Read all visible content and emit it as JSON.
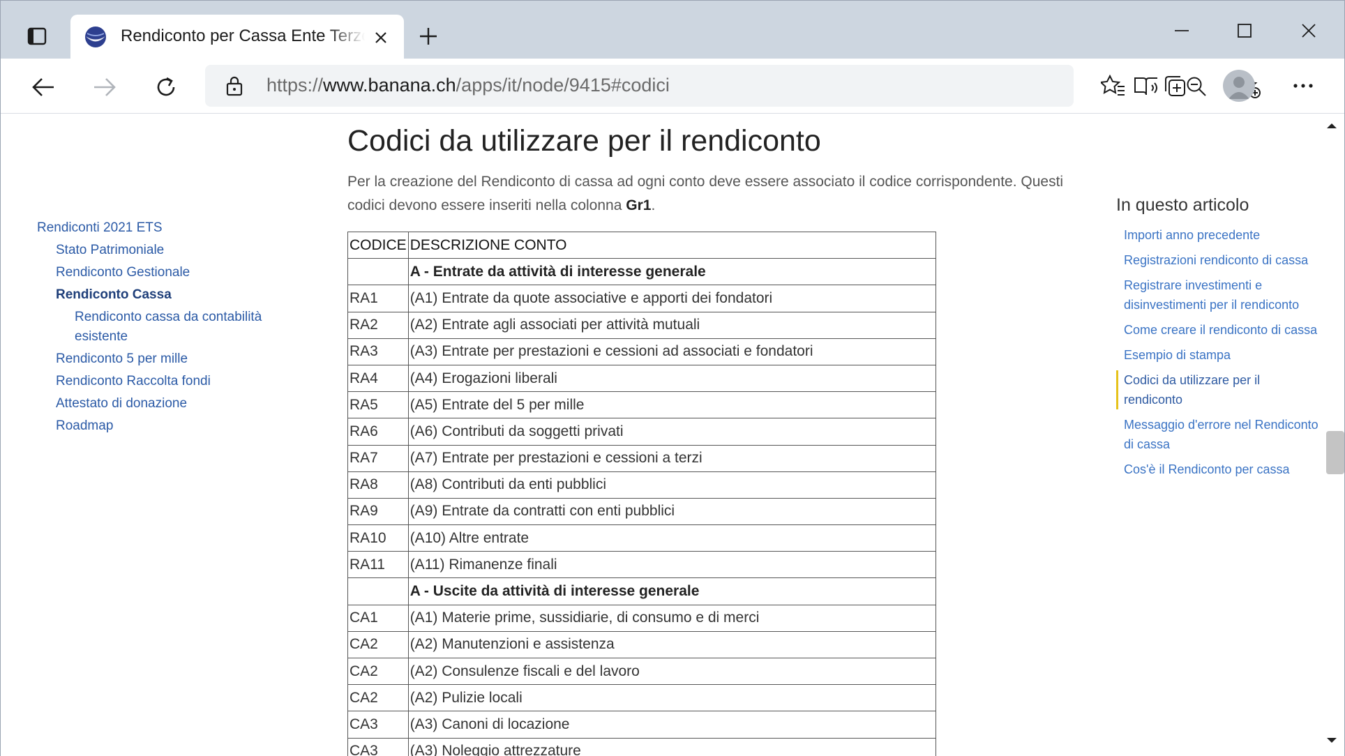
{
  "browser": {
    "tab": {
      "title": "Rendiconto per Cassa Ente Terzo Settore"
    },
    "address": {
      "scheme": "https://",
      "host": "www.banana.ch",
      "path": "/apps/it/node/9415#codici"
    },
    "icons": {
      "tab_actions": "tab-actions-icon",
      "favicon": "banana-logo-icon",
      "close_tab": "close-icon",
      "new_tab": "plus-icon",
      "minimize": "minimize-icon",
      "maximize": "maximize-icon",
      "close_window": "close-icon",
      "back": "arrow-left-icon",
      "forward": "arrow-right-icon",
      "refresh": "refresh-icon",
      "lock": "lock-icon",
      "read_aloud": "immersive-reader-icon",
      "zoom": "zoom-out-icon",
      "add_favorite": "star-add-icon",
      "favorites": "favorites-icon",
      "collections": "collections-icon",
      "profile": "profile-avatar-icon",
      "menu": "more-icon"
    },
    "colors": {
      "titlebar": "#cdd6e0",
      "link": "#2b5aa6",
      "toc_accent": "#e6c21a"
    }
  },
  "left_nav": {
    "items": [
      {
        "label": "Rendiconti 2021 ETS",
        "level": 1
      },
      {
        "label": "Stato Patrimoniale",
        "level": 2
      },
      {
        "label": "Rendiconto Gestionale",
        "level": 2
      },
      {
        "label": "Rendiconto Cassa",
        "level": 2,
        "active": true
      },
      {
        "label": "Rendiconto cassa da contabilità esistente",
        "level": 3
      },
      {
        "label": "Rendiconto 5 per mille",
        "level": 2
      },
      {
        "label": "Rendiconto Raccolta fondi",
        "level": 2
      },
      {
        "label": "Attestato di donazione",
        "level": 2
      },
      {
        "label": "Roadmap",
        "level": 2
      }
    ]
  },
  "article": {
    "title": "Codici da utilizzare per il rendiconto",
    "intro_before": "Per la creazione del Rendiconto di cassa ad ogni conto deve essere associato il codice corrispondente. Questi codici devono essere inseriti nella colonna ",
    "intro_bold": "Gr1",
    "intro_after": ".",
    "table": {
      "headers": [
        "CODICE",
        "DESCRIZIONE CONTO"
      ],
      "rows": [
        {
          "code": "",
          "desc": "A - Entrate da attività di interesse generale",
          "section": true
        },
        {
          "code": "RA1",
          "desc": "(A1) Entrate da quote associative e apporti dei fondatori"
        },
        {
          "code": "RA2",
          "desc": "(A2) Entrate agli associati per attività mutuali"
        },
        {
          "code": "RA3",
          "desc": "(A3) Entrate per prestazioni e cessioni ad associati e fondatori"
        },
        {
          "code": "RA4",
          "desc": "(A4) Erogazioni liberali"
        },
        {
          "code": "RA5",
          "desc": "(A5) Entrate del 5 per mille"
        },
        {
          "code": "RA6",
          "desc": "(A6) Contributi da soggetti privati"
        },
        {
          "code": "RA7",
          "desc": "(A7) Entrate per prestazioni e cessioni a terzi"
        },
        {
          "code": "RA8",
          "desc": "(A8) Contributi da enti pubblici"
        },
        {
          "code": "RA9",
          "desc": "(A9) Entrate da contratti con enti pubblici"
        },
        {
          "code": "RA10",
          "desc": "(A10) Altre entrate"
        },
        {
          "code": "RA11",
          "desc": "(A11) Rimanenze finali"
        },
        {
          "code": "",
          "desc": "A - Uscite da attività di interesse generale",
          "section": true
        },
        {
          "code": "CA1",
          "desc": "(A1) Materie prime, sussidiarie, di consumo e di merci"
        },
        {
          "code": "CA2",
          "desc": "(A2) Manutenzioni e assistenza"
        },
        {
          "code": "CA2",
          "desc": "(A2) Consulenze fiscali e del lavoro"
        },
        {
          "code": "CA2",
          "desc": "(A2) Pulizie locali"
        },
        {
          "code": "CA3",
          "desc": "(A3) Canoni di locazione"
        },
        {
          "code": "CA3",
          "desc": "(A3) Noleggio attrezzature"
        }
      ]
    }
  },
  "toc": {
    "title": "In questo articolo",
    "items": [
      {
        "label": "Importi anno precedente"
      },
      {
        "label": "Registrazioni rendiconto di cassa"
      },
      {
        "label": "Registrare investimenti e disinvestimenti per il rendiconto"
      },
      {
        "label": "Come creare il rendiconto di cassa"
      },
      {
        "label": "Esempio di stampa"
      },
      {
        "label": "Codici da utilizzare per il rendiconto",
        "active": true
      },
      {
        "label": "Messaggio d'errore nel Rendiconto di cassa"
      },
      {
        "label": "Cos'è il Rendiconto per cassa"
      }
    ]
  }
}
